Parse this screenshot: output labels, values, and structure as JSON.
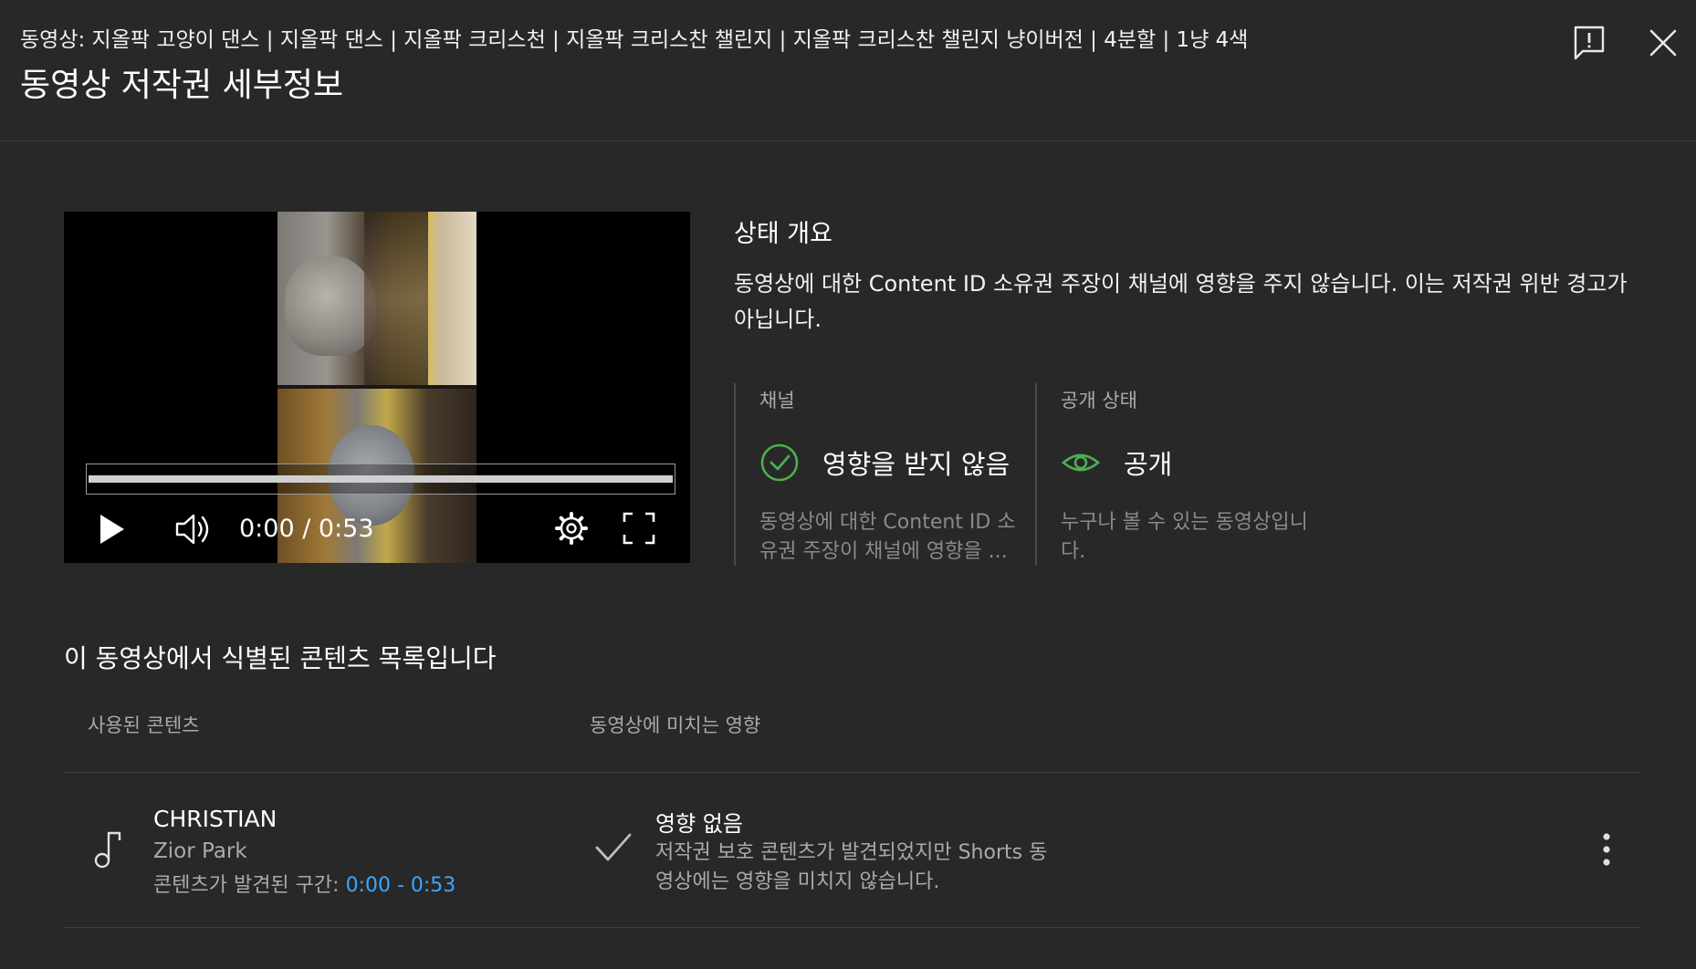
{
  "header": {
    "video_title": "동영상: 지올팍 고양이 댄스 | 지올팍 댄스 | 지올팍 크리스천 | 지올팍 크리스찬 챌린지 | 지올팍 크리스찬 챌린지 냥이버전 | 4분할 | 1냥 4색",
    "dialog_title": "동영상 저작권 세부정보",
    "icons": {
      "feedback": "feedback-icon",
      "close": "close-icon"
    }
  },
  "player": {
    "time": "0:00 / 0:53",
    "progress": 1.0,
    "icons": {
      "play": "play-icon",
      "volume": "volume-icon",
      "settings": "gear-icon",
      "fullscreen": "fullscreen-icon"
    }
  },
  "status": {
    "heading": "상태 개요",
    "description": "동영상에 대한 Content ID 소유권 주장이 채널에 영향을 주지 않습니다. 이는 저작권 위반 경고가 아닙니다.",
    "channel": {
      "label": "채널",
      "value": "영향을 받지 않음",
      "description": "동영상에 대한 Content ID 소유권 주장이 채널에 영향을 ...",
      "icon": "check-circle-icon"
    },
    "visibility": {
      "label": "공개 상태",
      "value": "공개",
      "description": "누구나 볼 수 있는 동영상입니다.",
      "icon": "eye-icon"
    }
  },
  "content_list": {
    "heading": "이 동영상에서 식별된 콘텐츠 목록입니다",
    "columns": {
      "used": "사용된 콘텐츠",
      "impact": "동영상에 미치는 영향"
    },
    "items": [
      {
        "title": "CHRISTIAN",
        "artist": "Zior Park",
        "found_label": "콘텐츠가 발견된 구간: ",
        "found_range": "0:00 - 0:53",
        "impact_title": "영향 없음",
        "impact_description": "저작권 보호 콘텐츠가 발견되었지만 Shorts 동영상에는 영향을 미치지 않습니다.",
        "icons": {
          "type": "music-note-icon",
          "impact": "check-icon",
          "menu": "more-vert-icon"
        }
      }
    ]
  },
  "colors": {
    "background": "#282828",
    "accent_green": "#4caf50",
    "link_blue": "#3ea6ff",
    "secondary_text": "#aaaaaa"
  }
}
